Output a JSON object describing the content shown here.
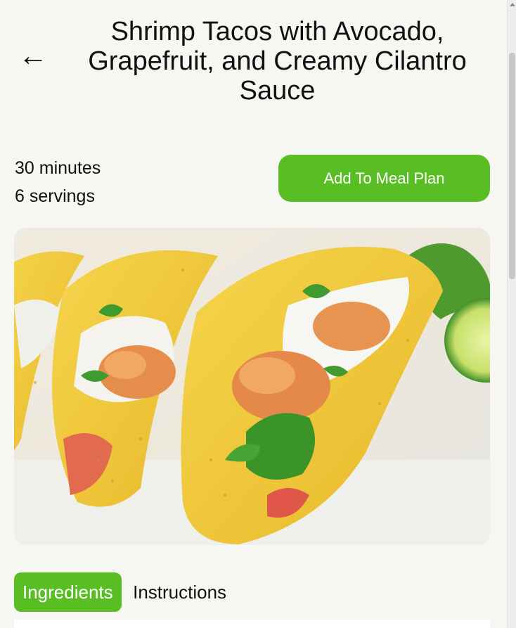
{
  "header": {
    "back_icon": "arrow-left-icon",
    "back_glyph": "←",
    "title": "Shrimp Tacos with Avocado, Grapefruit, and Creamy Cilantro Sauce"
  },
  "meta": {
    "time": "30 minutes",
    "servings": "6 servings"
  },
  "actions": {
    "add_to_meal_plan": "Add To Meal Plan"
  },
  "tabs": [
    {
      "label": "Ingredients",
      "active": true
    },
    {
      "label": "Instructions",
      "active": false
    }
  ],
  "colors": {
    "accent": "#58be24",
    "background": "#f6f7f2",
    "text": "#111111"
  }
}
